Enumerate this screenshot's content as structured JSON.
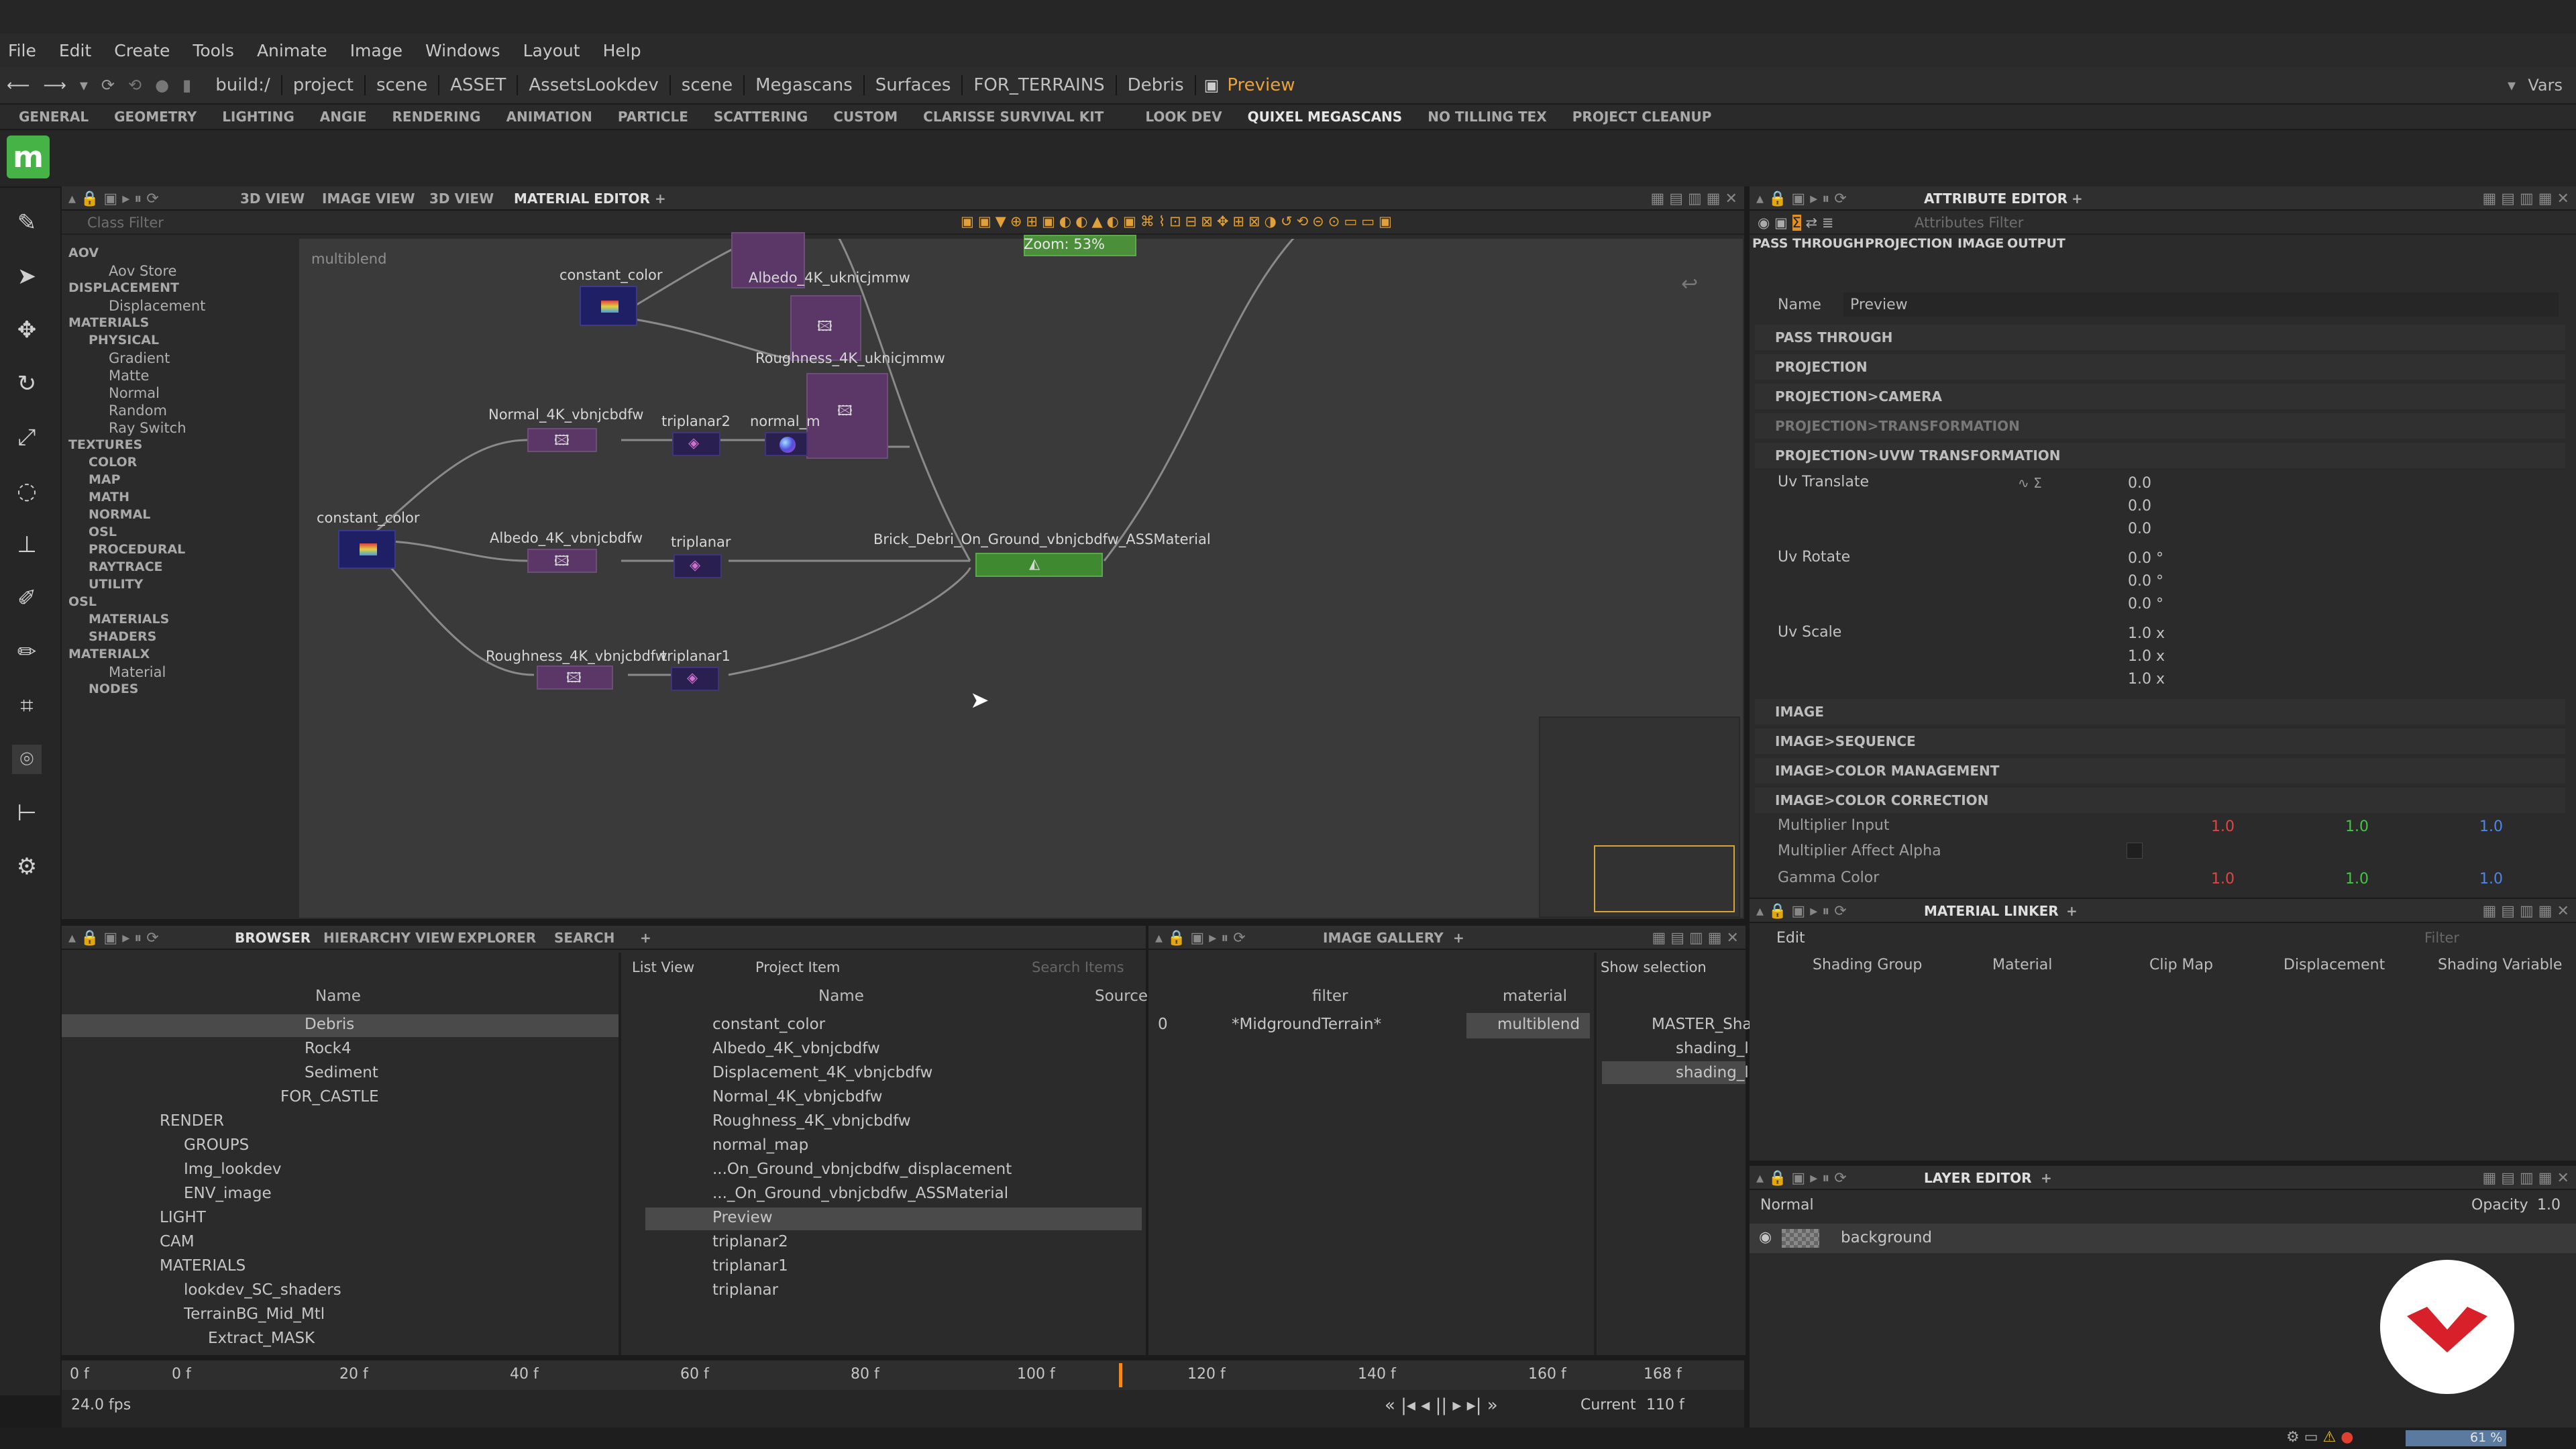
{
  "menu": [
    "File",
    "Edit",
    "Create",
    "Tools",
    "Animate",
    "Image",
    "Windows",
    "Layout",
    "Help"
  ],
  "path": [
    "build:/",
    "project",
    "scene",
    "ASSET",
    "AssetsLookdev",
    "scene",
    "Megascans",
    "Surfaces",
    "FOR_TERRAINS",
    "Debris"
  ],
  "path_current": "Preview",
  "vars": "Vars",
  "shelf": [
    "GENERAL",
    "GEOMETRY",
    "LIGHTING",
    "ANGIE",
    "RENDERING",
    "ANIMATION",
    "PARTICLE",
    "SCATTERING",
    "CUSTOM",
    "CLARISSE SURVIVAL KIT",
    "LOOK DEV",
    "QUIXEL MEGASCANS",
    "NO TILLING TEX",
    "PROJECT CLEANUP"
  ],
  "logo": "m",
  "view_tabs": [
    "3D VIEW",
    "IMAGE VIEW",
    "3D VIEW",
    "MATERIAL EDITOR"
  ],
  "class_filter": "Class Filter",
  "tree": {
    "aov": "AOV",
    "aov_store": "Aov Store",
    "displacement": "DISPLACEMENT",
    "displacement_item": "Displacement",
    "materials": "MATERIALS",
    "physical": "PHYSICAL",
    "gradient": "Gradient",
    "matte": "Matte",
    "normal": "Normal",
    "random": "Random",
    "ray_switch": "Ray Switch",
    "textures": "TEXTURES",
    "color": "COLOR",
    "map": "MAP",
    "math": "MATH",
    "normal2": "NORMAL",
    "osl": "OSL",
    "procedural": "PROCEDURAL",
    "raytrace": "RAYTRACE",
    "utility": "UTILITY",
    "osl2": "OSL",
    "osl_materials": "MATERIALS",
    "shaders": "SHADERS",
    "materialx": "MATERIALX",
    "material": "Material",
    "nodes": "NODES"
  },
  "graph": {
    "context": "multiblend",
    "zoom": "Zoom: 53%",
    "nodes": {
      "constant_color_top": "constant_color",
      "albedo_top": "Albedo_4K_uknicjmmw",
      "roughness_top": "Roughness_4K_uknicjmmw",
      "normal_mid": "Normal_4K_vbnjcbdfw",
      "triplanar2": "triplanar2",
      "normal_map": "normal_m",
      "constant_color_left": "constant_color",
      "albedo_mid": "Albedo_4K_vbnjcbdfw",
      "triplanar": "triplanar",
      "ass_material": "Brick_Debri_On_Ground_vbnjcbdfw_ASSMaterial",
      "roughness_mid": "Roughness_4K_vbnjcbdfw",
      "triplanar1": "triplanar1"
    }
  },
  "attr": {
    "title": "ATTRIBUTE EDITOR",
    "filter": "Attributes Filter",
    "tabs": [
      "PASS THROUGH",
      "PROJECTION",
      "IMAGE",
      "OUTPUT"
    ],
    "name_label": "Name",
    "name_value": "Preview",
    "sections": [
      "PASS THROUGH",
      "PROJECTION",
      "PROJECTION>CAMERA",
      "PROJECTION>TRANSFORMATION",
      "PROJECTION>UVW TRANSFORMATION"
    ],
    "uv_translate": "Uv Translate",
    "uv_translate_vals": [
      "0.0",
      "0.0",
      "0.0"
    ],
    "uv_rotate": "Uv Rotate",
    "uv_rotate_vals": [
      "0.0 °",
      "0.0 °",
      "0.0 °"
    ],
    "uv_scale": "Uv Scale",
    "uv_scale_vals": [
      "1.0 x",
      "1.0 x",
      "1.0 x"
    ],
    "sections2": [
      "IMAGE",
      "IMAGE>SEQUENCE",
      "IMAGE>COLOR MANAGEMENT",
      "IMAGE>COLOR CORRECTION"
    ],
    "mult_input": "Multiplier Input",
    "mult_vals": [
      "1.0",
      "1.0",
      "1.0"
    ],
    "mult_alpha": "Multiplier Affect Alpha",
    "gamma": "Gamma Color",
    "gamma_vals": [
      "1.0",
      "1.0",
      "1.0"
    ]
  },
  "browser": {
    "tabs": [
      "BROWSER",
      "HIERARCHY VIEW",
      "EXPLORER",
      "SEARCH"
    ],
    "col_name": "Name",
    "tree": [
      "Debris",
      "Rock4",
      "Sediment",
      "FOR_CASTLE",
      "RENDER",
      "GROUPS",
      "Img_lookdev",
      "ENV_image",
      "LIGHT",
      "CAM",
      "MATERIALS",
      "lookdev_SC_shaders",
      "TerrainBG_Mid_Mtl",
      "Extract_MASK"
    ],
    "list_view": "List View",
    "project_item": "Project Item",
    "search": "Search Items",
    "list_col_name": "Name",
    "list_col_source": "Source",
    "items": [
      "constant_color",
      "Albedo_4K_vbnjcbdfw",
      "Displacement_4K_vbnjcbdfw",
      "Normal_4K_vbnjcbdfw",
      "Roughness_4K_vbnjcbdfw",
      "normal_map",
      "...On_Ground_vbnjcbdfw_displacement",
      "..._On_Ground_vbnjcbdfw_ASSMaterial",
      "Preview",
      "triplanar2",
      "triplanar1",
      "triplanar"
    ]
  },
  "gallery": {
    "title": "IMAGE GALLERY",
    "show_selection": "Show selection",
    "col_filter": "filter",
    "col_material": "material",
    "row_index": "0",
    "row_filter": "*MidgroundTerrain*",
    "row_material": "multiblend",
    "tree": [
      "MASTER_Sha",
      "shading_l",
      "shading_l"
    ]
  },
  "linker": {
    "title": "MATERIAL LINKER",
    "edit": "Edit",
    "filter": "Filter",
    "cols": [
      "Shading Group",
      "Material",
      "Clip Map",
      "Displacement",
      "Shading Variable"
    ]
  },
  "layer": {
    "title": "LAYER EDITOR",
    "blend": "Normal",
    "opacity_label": "Opacity",
    "opacity": "1.0",
    "item": "background"
  },
  "timeline": {
    "start": "0 f",
    "ticks": [
      "0 f",
      "20 f",
      "40 f",
      "60 f",
      "80 f",
      "100 f",
      "120 f",
      "140 f",
      "160 f"
    ],
    "end": "168 f",
    "fps": "24.0 fps",
    "current_label": "Current",
    "current": "110 f"
  },
  "status": {
    "zoom": "61 %"
  }
}
